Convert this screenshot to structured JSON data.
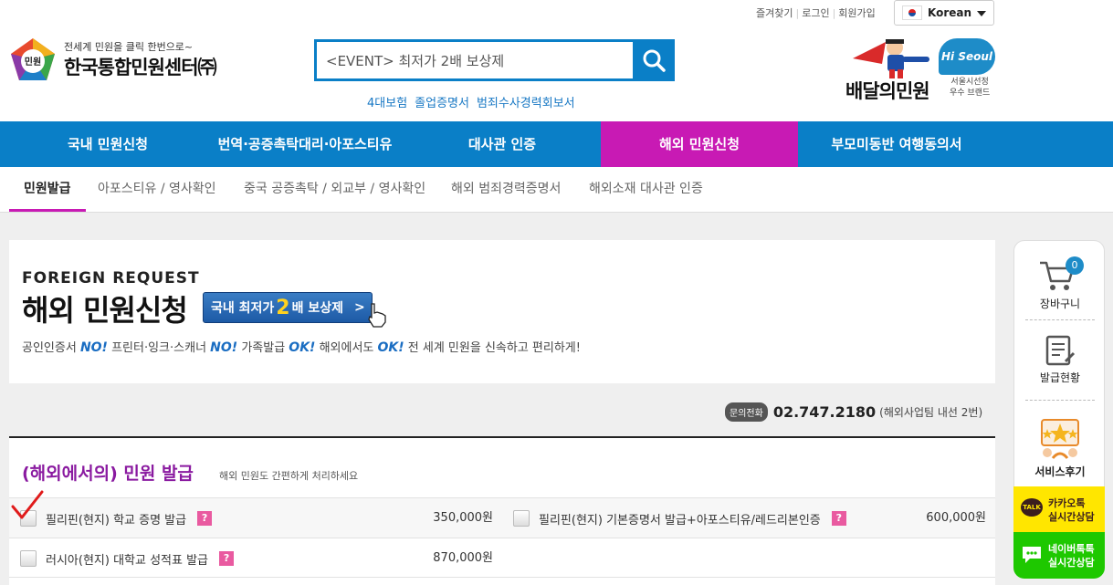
{
  "util_links": [
    "즐겨찾기",
    "로그인",
    "회원가입"
  ],
  "language": "Korean",
  "logo": {
    "badge": "민원",
    "tagline": "전세계 민원을 클릭 한번으로~",
    "name": "한국통합민원센터㈜"
  },
  "search": {
    "value": "<EVENT> 최저가 2배 보상제"
  },
  "quick_links": [
    "4대보험",
    "졸업증명서",
    "범죄수사경력회보서"
  ],
  "brand": {
    "name": "배달의민원",
    "hi_text": "Hi Seoul",
    "caption_line1": "서울시선정",
    "caption_line2": "우수 브랜드"
  },
  "main_nav": [
    "국내 민원신청",
    "번역·공증촉탁대리·아포스티유",
    "대사관 인증",
    "해외 민원신청",
    "부모미동반 여행동의서"
  ],
  "sub_nav": [
    "민원발급",
    "아포스티유 / 영사확인",
    "중국 공증촉탁 / 외교부 / 영사확인",
    "해외 범죄경력증명서",
    "해외소재 대사관 인증"
  ],
  "banner": {
    "en_title": "FOREIGN REQUEST",
    "ko_title": "해외 민원신청",
    "badge_pre": "국내 최저가",
    "badge_num": "2",
    "badge_post": "배 보상제",
    "desc": {
      "p1": "공인인증서 ",
      "no1": "NO!",
      "p2": " 프린터·잉크·스캐너 ",
      "no2": "NO!",
      "p3": " 가족발급 ",
      "ok1": "OK!",
      "p4": " 해외에서도 ",
      "ok2": "OK!",
      "p5": " 전 세계 민원을 신속하고 편리하게!"
    }
  },
  "contact": {
    "label": "문의전화",
    "number": "02.747.2180",
    "note": "(해외사업팀 내선 2번)"
  },
  "section": {
    "title": "(해외에서의) 민원 발급",
    "subtitle": "해외 민원도 간편하게 처리하세요"
  },
  "items": [
    {
      "name": "필리핀(현지) 학교 증명 발급",
      "price": "350,000원"
    },
    {
      "name": "필리핀(현지) 기본증명서 발급+아포스티유/레드리본인증",
      "price": "600,000원"
    },
    {
      "name": "러시아(현지) 대학교 성적표 발급",
      "price": "870,000원"
    }
  ],
  "help_mark": "?",
  "quick_menu": {
    "cart_label": "장바구니",
    "cart_count": "0",
    "status_label": "발급현황",
    "review_label": "서비스후기",
    "kakao_line1": "카카오톡",
    "kakao_line2": "실시간상담",
    "kakao_badge": "TALK",
    "naver_line1": "네이버톡톡",
    "naver_line2": "실시간상담"
  },
  "colors": {
    "primary": "#0a7fc7",
    "accent": "#c81ab4",
    "kakao": "#ffe600",
    "naver": "#1ec800"
  }
}
